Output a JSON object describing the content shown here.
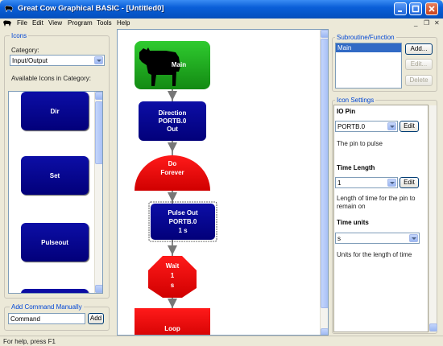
{
  "window": {
    "title": "Great Cow Graphical BASIC - [Untitled0]"
  },
  "menu": {
    "items": [
      "File",
      "Edit",
      "View",
      "Program",
      "Tools",
      "Help"
    ]
  },
  "icons_panel": {
    "group_label": "Icons",
    "category_label": "Category:",
    "category_value": "Input/Output",
    "available_label": "Available Icons in Category:",
    "icons": [
      "Dir",
      "Set",
      "Pulseout"
    ]
  },
  "add_command": {
    "group_label": "Add Command Manually",
    "input_value": "Command",
    "add_label": "Add"
  },
  "flowchart": {
    "main_label": "Main",
    "direction": [
      "Direction",
      "PORTB.0",
      "Out"
    ],
    "do_forever": [
      "Do",
      "Forever"
    ],
    "pulse_out": [
      "Pulse Out",
      "PORTB.0",
      "1 s"
    ],
    "wait": [
      "Wait",
      "1",
      "s"
    ],
    "loop": "Loop"
  },
  "subroutine_panel": {
    "group_label": "Subroutine/Function",
    "items": [
      "Main"
    ],
    "add_label": "Add...",
    "edit_label": "Edit...",
    "delete_label": "Delete"
  },
  "settings_panel": {
    "group_label": "Icon Settings",
    "io_pin": {
      "title": "IO Pin",
      "value": "PORTB.0",
      "edit_label": "Edit",
      "desc": "The pin to pulse"
    },
    "time_length": {
      "title": "Time Length",
      "value": "1",
      "edit_label": "Edit",
      "desc": "Length of time for the pin to remain on"
    },
    "time_units": {
      "title": "Time units",
      "value": "s",
      "desc": "Units for the length of time"
    }
  },
  "status": {
    "text": "For help, press F1"
  },
  "colors": {
    "title_blue": "#0553c4",
    "block_blue": "#02007a",
    "red": "#e00000",
    "green": "#1ea81e"
  }
}
